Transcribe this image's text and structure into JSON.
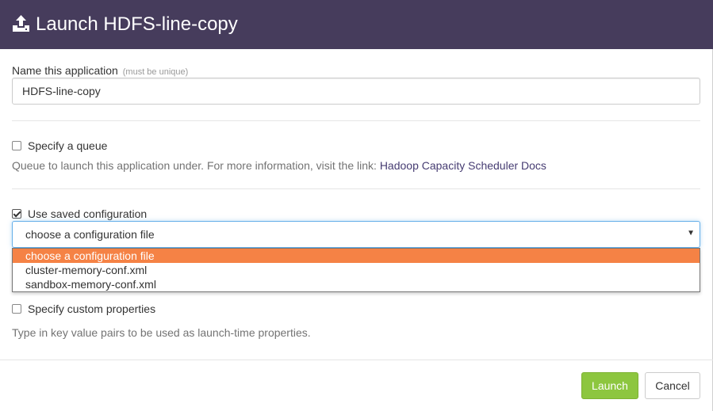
{
  "header": {
    "title": "Launch HDFS-line-copy",
    "icon": "upload-icon"
  },
  "name_field": {
    "label": "Name this application",
    "hint": "(must be unique)",
    "value": "HDFS-line-copy"
  },
  "queue": {
    "checkbox_label": "Specify a queue",
    "checked": false,
    "help_text": "Queue to launch this application under. For more information, visit the link: ",
    "link_text": "Hadoop Capacity Scheduler Docs"
  },
  "saved_config": {
    "checkbox_label": "Use saved configuration",
    "checked": true,
    "selected": "choose a configuration file",
    "options": [
      "choose a configuration file",
      "cluster-memory-conf.xml",
      "sandbox-memory-conf.xml"
    ]
  },
  "custom_properties": {
    "checkbox_label": "Specify custom properties",
    "checked": false,
    "help_text": "Type in key value pairs to be used as launch-time properties."
  },
  "footer": {
    "launch_label": "Launch",
    "cancel_label": "Cancel"
  },
  "colors": {
    "header_bg": "#463c5c",
    "launch_bg": "#8dc63f",
    "option_highlight": "#f58245",
    "link": "#463c72"
  }
}
